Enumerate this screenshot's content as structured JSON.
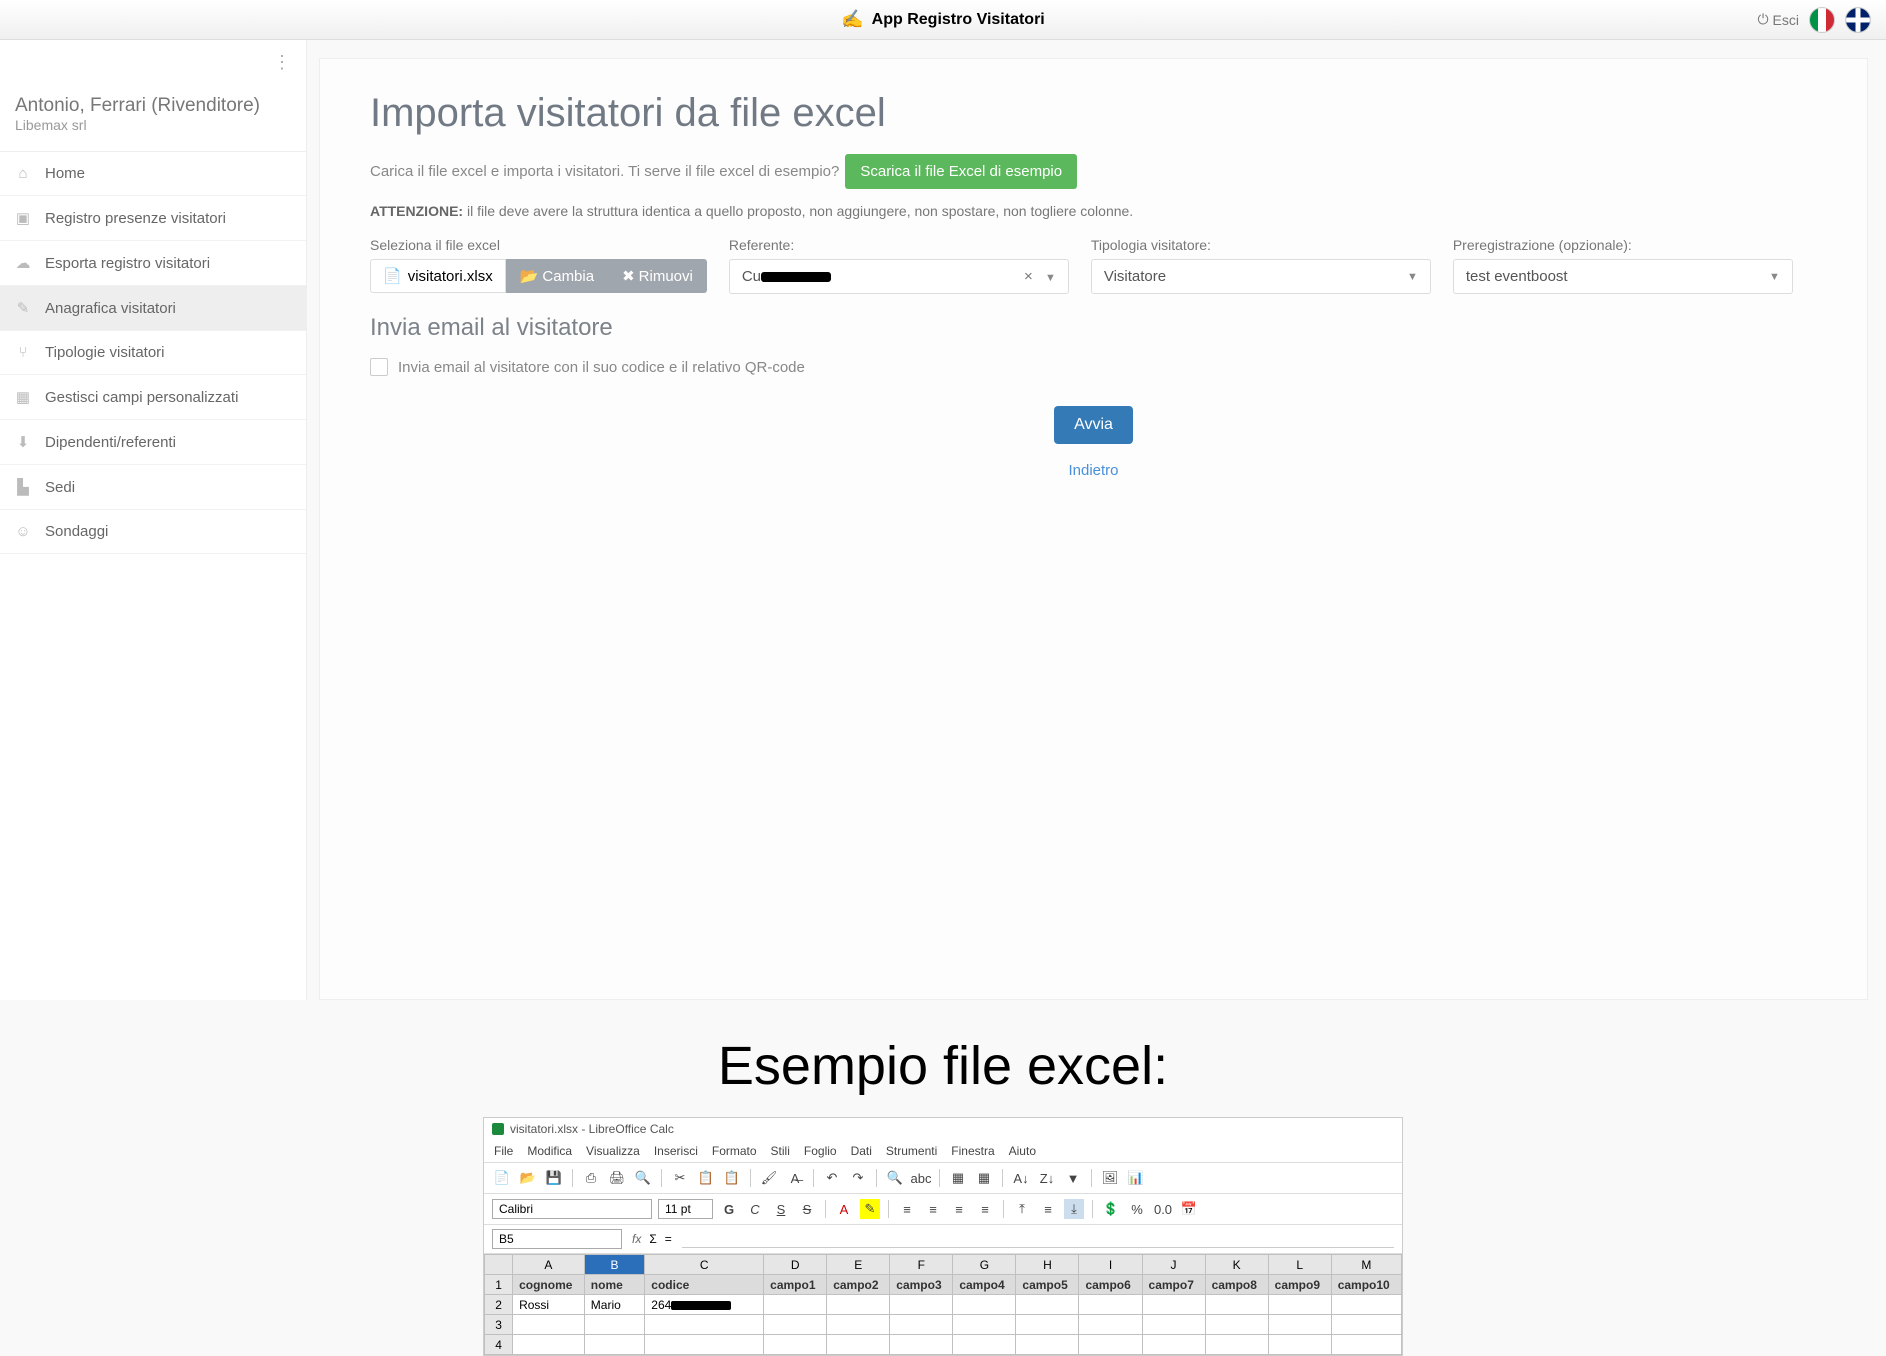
{
  "topbar": {
    "app_title": "App Registro Visitatori",
    "esci_label": "Esci"
  },
  "profile": {
    "name": "Antonio, Ferrari (Rivenditore)",
    "company": "Libemax srl"
  },
  "nav": {
    "home": "Home",
    "registro": "Registro presenze visitatori",
    "esporta": "Esporta registro visitatori",
    "anagrafica": "Anagrafica visitatori",
    "tipologie": "Tipologie visitatori",
    "campi": "Gestisci campi personalizzati",
    "dipendenti": "Dipendenti/referenti",
    "sedi": "Sedi",
    "sondaggi": "Sondaggi"
  },
  "page": {
    "title": "Importa visitatori da file excel",
    "upload_info": "Carica il file excel e importa i visitatori. Ti serve il file excel di esempio?",
    "download_btn": "Scarica il file Excel di esempio",
    "attention_label": "ATTENZIONE:",
    "attention_text": "il file deve avere la struttura identica a quello proposto, non aggiungere, non spostare, non togliere colonne.",
    "labels": {
      "file": "Seleziona il file excel",
      "referente": "Referente:",
      "tipologia": "Tipologia visitatore:",
      "prereg": "Preregistrazione (opzionale):"
    },
    "file": {
      "name": "visitatori.xlsx",
      "cambia": "Cambia",
      "rimuovi": "Rimuovi"
    },
    "referente_value_prefix": "Cu",
    "tipologia_value": "Visitatore",
    "prereg_value": "test eventboost",
    "email_section_title": "Invia email al visitatore",
    "email_checkbox_label": "Invia email al visitatore con il suo codice e il relativo QR-code",
    "avvia_btn": "Avvia",
    "back_link": "Indietro"
  },
  "example": {
    "heading": "Esempio file excel:",
    "window_title": "visitatori.xlsx - LibreOffice Calc",
    "menu": [
      "File",
      "Modifica",
      "Visualizza",
      "Inserisci",
      "Formato",
      "Stili",
      "Foglio",
      "Dati",
      "Strumenti",
      "Finestra",
      "Aiuto"
    ],
    "font_name": "Calibri",
    "font_size": "11 pt",
    "cell_ref": "B5",
    "fx": "fx",
    "sigma": "Σ",
    "eq": "=",
    "columns": [
      "A",
      "B",
      "C",
      "D",
      "E",
      "F",
      "G",
      "H",
      "I",
      "J",
      "K",
      "L",
      "M"
    ],
    "selected_col": "B",
    "header_row": [
      "cognome",
      "nome",
      "codice",
      "campo1",
      "campo2",
      "campo3",
      "campo4",
      "campo5",
      "campo6",
      "campo7",
      "campo8",
      "campo9",
      "campo10"
    ],
    "data_row": {
      "cognome": "Rossi",
      "nome": "Mario",
      "codice_prefix": "264"
    }
  }
}
